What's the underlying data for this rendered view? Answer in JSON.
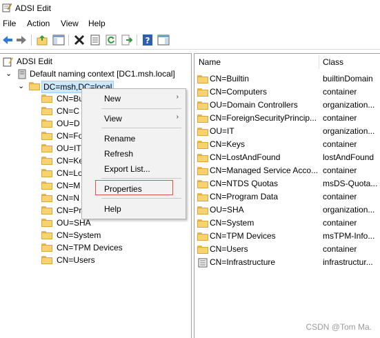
{
  "window": {
    "title": "ADSI Edit"
  },
  "menubar": [
    "File",
    "Action",
    "View",
    "Help"
  ],
  "toolbar": [
    "back-icon",
    "forward-icon",
    "up-folder-icon",
    "show-hide-tree-icon",
    "delete-icon",
    "properties-icon",
    "refresh-icon",
    "export-icon",
    "help-icon",
    "show-hide-action-pane-icon"
  ],
  "tree": {
    "root": "ADSI Edit",
    "context": "Default naming context [DC1.msh.local]",
    "domain": "DC=msh,DC=local",
    "children": [
      "CN=Bu",
      "CN=C",
      "OU=D",
      "CN=Fo",
      "OU=IT",
      "CN=Ke",
      "CN=Lo",
      "CN=M",
      "CN=N",
      "CN=Pr",
      "OU=SHA",
      "CN=System",
      "CN=TPM Devices",
      "CN=Users"
    ]
  },
  "list": {
    "headers": {
      "name": "Name",
      "class": "Class"
    },
    "rows": [
      {
        "name": "CN=Builtin",
        "class": "builtinDomain"
      },
      {
        "name": "CN=Computers",
        "class": "container"
      },
      {
        "name": "OU=Domain Controllers",
        "class": "organization..."
      },
      {
        "name": "CN=ForeignSecurityPrincip...",
        "class": "container"
      },
      {
        "name": "OU=IT",
        "class": "organization..."
      },
      {
        "name": "CN=Keys",
        "class": "container"
      },
      {
        "name": "CN=LostAndFound",
        "class": "lostAndFound"
      },
      {
        "name": "CN=Managed Service Acco...",
        "class": "container"
      },
      {
        "name": "CN=NTDS Quotas",
        "class": "msDS-Quota..."
      },
      {
        "name": "CN=Program Data",
        "class": "container"
      },
      {
        "name": "OU=SHA",
        "class": "organization..."
      },
      {
        "name": "CN=System",
        "class": "container"
      },
      {
        "name": "CN=TPM Devices",
        "class": "msTPM-Info..."
      },
      {
        "name": "CN=Users",
        "class": "container"
      },
      {
        "name": "CN=Infrastructure",
        "class": "infrastructur..."
      }
    ]
  },
  "context_menu": {
    "items": {
      "new": "New",
      "view": "View",
      "rename": "Rename",
      "refresh": "Refresh",
      "export_list": "Export List...",
      "properties": "Properties",
      "help": "Help"
    },
    "submenu_arrow": "›"
  },
  "watermark": "CSDN @Tom Ma.",
  "colors": {
    "selection": "#cce8ff",
    "folder": "#f7d36d",
    "highlight_box": "#d9534f"
  }
}
